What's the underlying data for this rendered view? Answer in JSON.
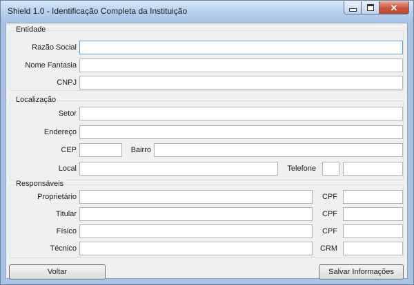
{
  "window": {
    "title": "Shield 1.0 - Identificação Completa da Instituição"
  },
  "entidade": {
    "legend": "Entidade",
    "razao_social": "Razão Social",
    "nome_fantasia": "Nome Fantasia",
    "cnpj": "CNPJ"
  },
  "localizacao": {
    "legend": "Localização",
    "setor": "Setor",
    "endereco": "Endereço",
    "cep": "CEP",
    "bairro": "Bairro",
    "local": "Local",
    "telefone": "Telefone"
  },
  "responsaveis": {
    "legend": "Responsáveis",
    "proprietario": "Proprietário",
    "titular": "Titular",
    "fisico": "Físico",
    "tecnico": "Técnico",
    "cpf": "CPF",
    "crm": "CRM"
  },
  "buttons": {
    "voltar": "Voltar",
    "salvar": "Salvar Informações"
  }
}
